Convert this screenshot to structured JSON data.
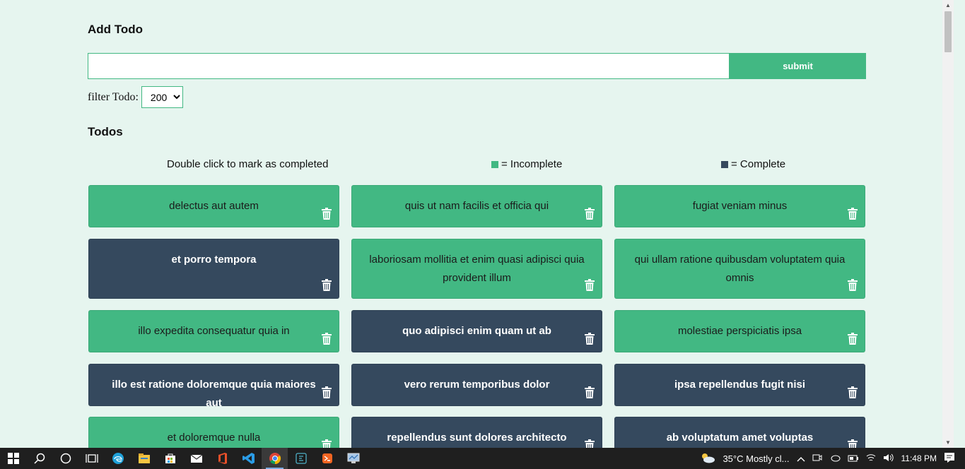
{
  "add": {
    "heading": "Add Todo",
    "input_value": "",
    "input_placeholder": "",
    "submit_label": "submit"
  },
  "filter": {
    "label": "filter Todo:",
    "selected": "200",
    "options": [
      "200"
    ]
  },
  "todos_heading": "Todos",
  "legend": {
    "hint": "Double click to mark as completed",
    "incomplete": "= Incomplete",
    "complete": "= Complete"
  },
  "colors": {
    "incomplete": "#42b883",
    "complete": "#35495e",
    "background": "#e6f5ef"
  },
  "todos": [
    {
      "title": "delectus aut autem",
      "completed": false
    },
    {
      "title": "quis ut nam facilis et officia qui",
      "completed": false
    },
    {
      "title": "fugiat veniam minus",
      "completed": false
    },
    {
      "title": "et porro tempora",
      "completed": true
    },
    {
      "title": "laboriosam mollitia et enim quasi adipisci quia provident illum",
      "completed": false
    },
    {
      "title": "qui ullam ratione quibusdam voluptatem quia omnis",
      "completed": false
    },
    {
      "title": "illo expedita consequatur quia in",
      "completed": false
    },
    {
      "title": "quo adipisci enim quam ut ab",
      "completed": true
    },
    {
      "title": "molestiae perspiciatis ipsa",
      "completed": false
    },
    {
      "title": "illo est ratione doloremque quia maiores aut",
      "completed": true
    },
    {
      "title": "vero rerum temporibus dolor",
      "completed": true
    },
    {
      "title": "ipsa repellendus fugit nisi",
      "completed": true
    },
    {
      "title": "et doloremque nulla",
      "completed": false
    },
    {
      "title": "repellendus sunt dolores architecto",
      "completed": true
    },
    {
      "title": "ab voluptatum amet voluptas",
      "completed": true
    }
  ],
  "taskbar": {
    "apps": [
      "start-icon",
      "search-icon",
      "cortana-icon",
      "task-view-icon",
      "edge-icon",
      "file-explorer-icon",
      "store-icon",
      "mail-icon",
      "office-icon",
      "vscode-icon",
      "chrome-icon",
      "terminal-icon",
      "app-icon",
      "monitor-icon"
    ],
    "weather": "35°C  Mostly cl...",
    "time": "11:48 PM"
  }
}
